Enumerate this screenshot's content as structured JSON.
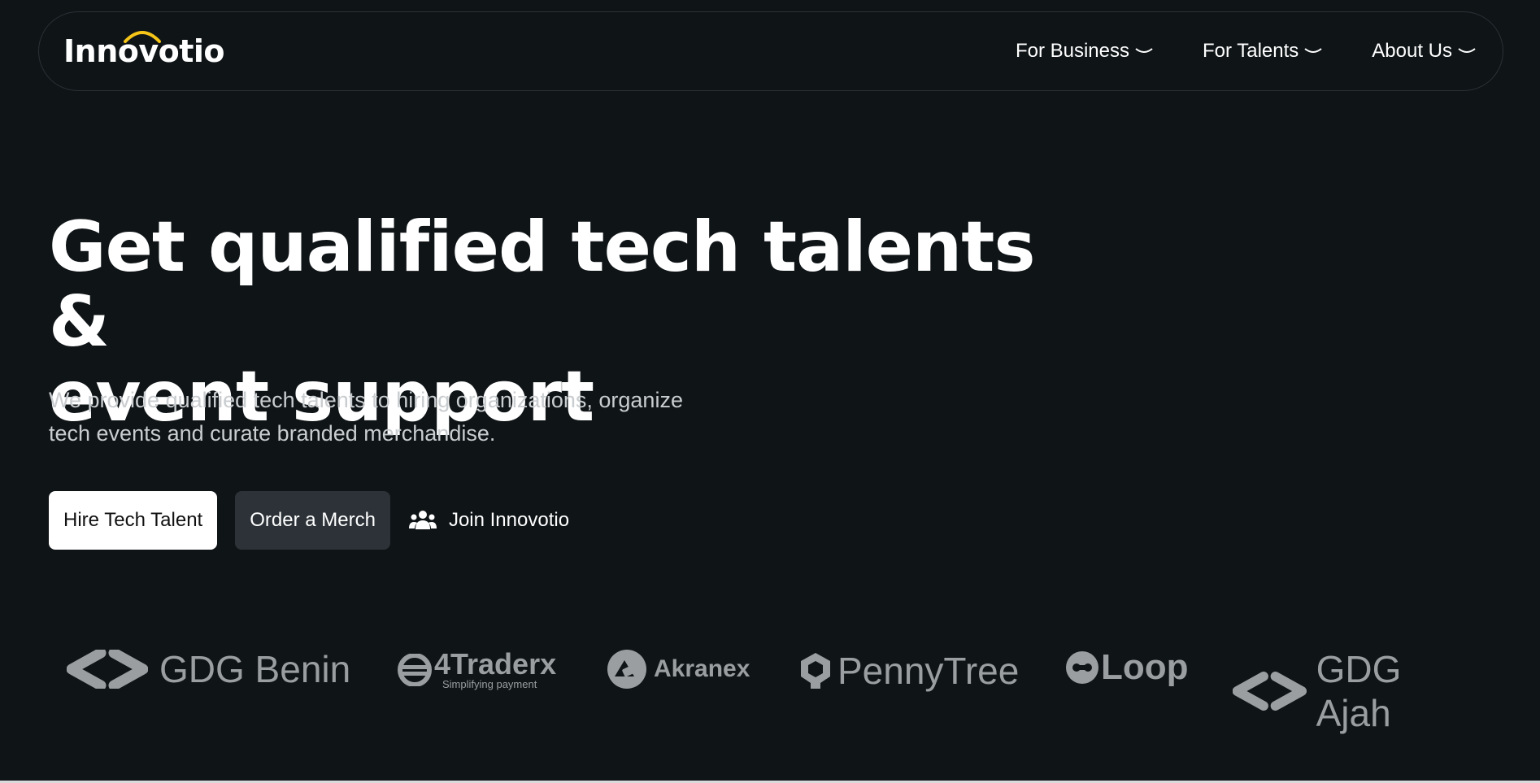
{
  "nav": {
    "logo_text": "Innovotio",
    "items": [
      {
        "label": "For Business"
      },
      {
        "label": "For Talents"
      },
      {
        "label": "About Us"
      }
    ]
  },
  "hero": {
    "title_line1": "Get qualified tech talents &",
    "title_line2": "event support",
    "description_line1": "We provide qualified tech talents to hiring organizations, organize",
    "description_line2": "tech events and curate branded merchandise.",
    "buttons": {
      "hire": "Hire Tech Talent",
      "merch": "Order a Merch",
      "join": "Join Innovotio"
    }
  },
  "partners": [
    {
      "name": "GDG Benin",
      "icon": "gdg-chevrons-icon"
    },
    {
      "name": "4Traderx",
      "tagline": "Simplifying payment",
      "icon": "traderx-icon"
    },
    {
      "name": "Akranex",
      "icon": "akranex-icon"
    },
    {
      "name": "PennyTree",
      "icon": "pennytree-icon"
    },
    {
      "name": "Loop",
      "icon": "loop-icon"
    },
    {
      "name": "GDG Ajah",
      "icon": "gdg-chevrons-icon"
    }
  ],
  "colors": {
    "background": "#0f1417",
    "accent_yellow": "#f5c518",
    "partner_gray": "#9a9ea1",
    "secondary_button": "#2c3237"
  }
}
